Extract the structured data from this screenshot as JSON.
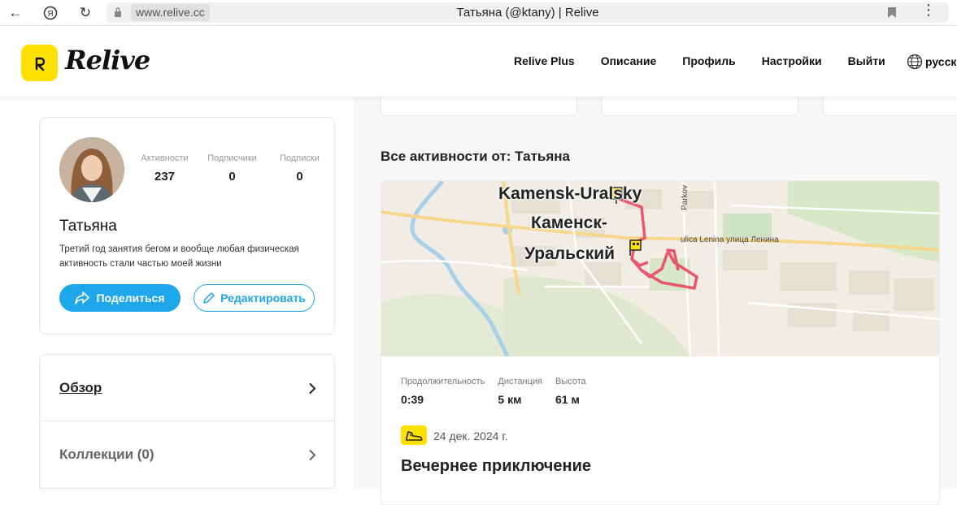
{
  "browser": {
    "url": "www.relive.cc",
    "tab_title": "Татьяна (@ktany) | Relive"
  },
  "header": {
    "logo_text": "Relive",
    "nav": [
      "Relive Plus",
      "Описание",
      "Профиль",
      "Настройки",
      "Выйти"
    ],
    "language": "русский"
  },
  "profile": {
    "name": "Татьяна",
    "bio": "Третий год занятия бегом и вообще любая физическая активность стали частью моей жизни",
    "stats": [
      {
        "label": "Активности",
        "value": "237"
      },
      {
        "label": "Подписчики",
        "value": "0"
      },
      {
        "label": "Подписки",
        "value": "0"
      }
    ],
    "share_label": "Поделиться",
    "edit_label": "Редактировать"
  },
  "menu": {
    "overview": "Обзор",
    "collections": "Коллекции (0)"
  },
  "feed": {
    "title": "Все активности от: Татьяна",
    "activity": {
      "map_labels": {
        "city_latin": "Kamensk-Uralsky",
        "city_ru_1": "Каменск-",
        "city_ru_2": "Уральский",
        "street": "ulica Lenina улица Ленина",
        "park": "Parkov"
      },
      "metrics": [
        {
          "label": "Продолжительность",
          "value": "0:39"
        },
        {
          "label": "Дистанция",
          "value": "5 км"
        },
        {
          "label": "Высота",
          "value": "61 м"
        }
      ],
      "date": "24 дек. 2024 г.",
      "title": "Вечернее приключение"
    }
  },
  "colors": {
    "brand_yellow": "#ffe000",
    "accent_blue": "#1ea7ea",
    "route_red": "#e8475f"
  }
}
